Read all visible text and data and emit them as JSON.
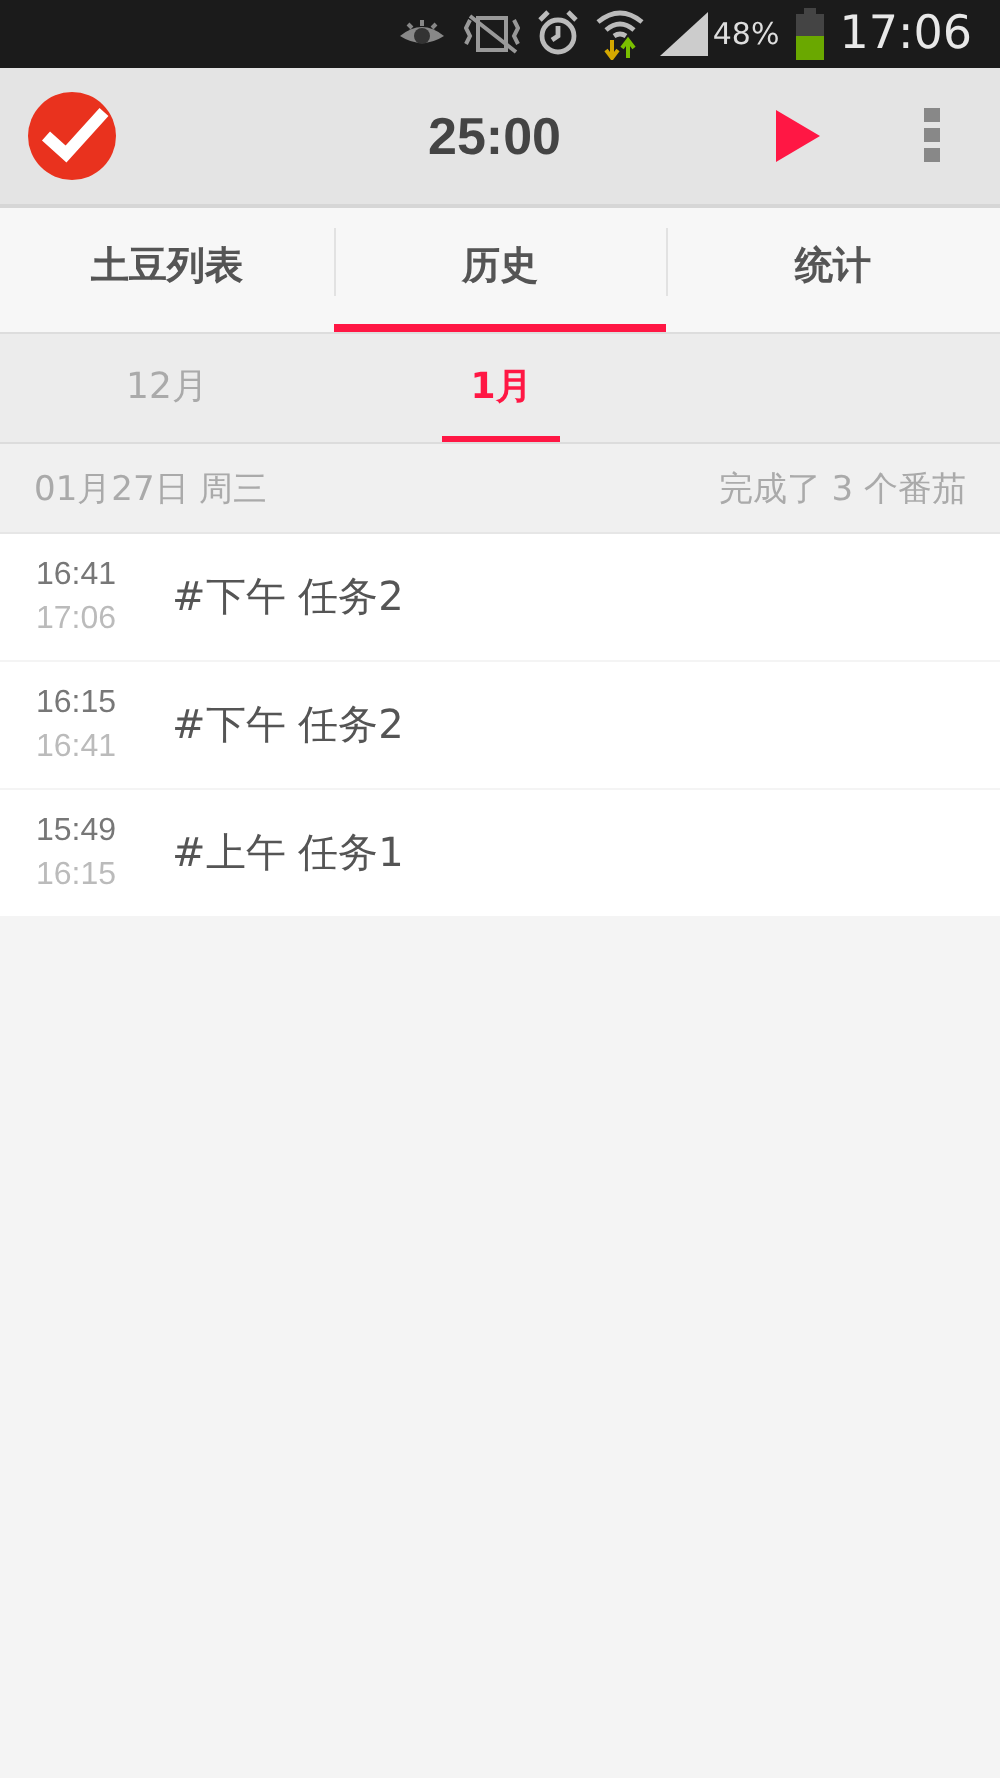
{
  "status_bar": {
    "battery": "48%",
    "time": "17:06"
  },
  "app_bar": {
    "timer": "25:00"
  },
  "tabs": [
    {
      "label": "土豆列表",
      "selected": false
    },
    {
      "label": "历史",
      "selected": true
    },
    {
      "label": "统计",
      "selected": false
    }
  ],
  "months": [
    {
      "label": "12月",
      "selected": false
    },
    {
      "label": "1月",
      "selected": true
    }
  ],
  "day": {
    "date": "01月27日 周三",
    "summary": "完成了 3 个番茄"
  },
  "entries": [
    {
      "start": "16:41",
      "end": "17:06",
      "task": "#下午 任务2"
    },
    {
      "start": "16:15",
      "end": "16:41",
      "task": "#下午 任务2"
    },
    {
      "start": "15:49",
      "end": "16:15",
      "task": "#上午 任务1"
    }
  ]
}
